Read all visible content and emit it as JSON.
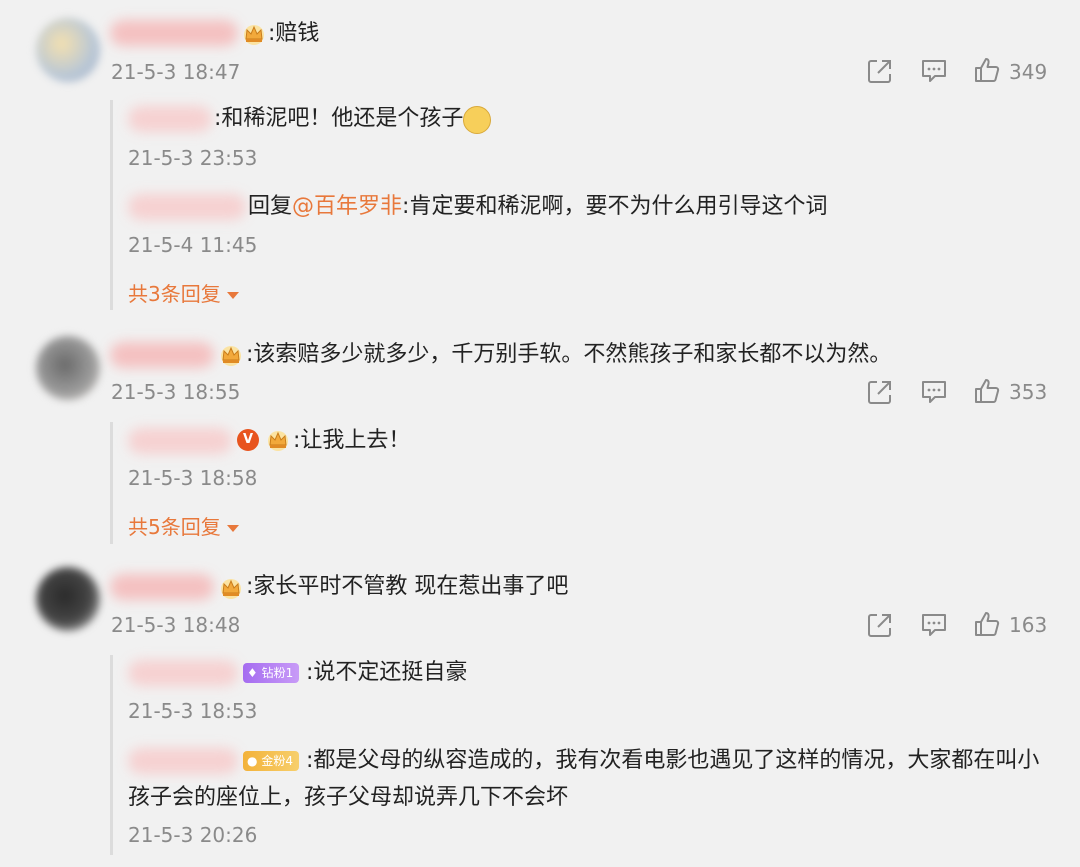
{
  "comments": [
    {
      "text": ":赔钱",
      "time": "21-5-3 18:47",
      "likes": "349",
      "replies": [
        {
          "text": ":和稀泥吧！他还是个孩子",
          "time": "21-5-3 23:53"
        },
        {
          "prefix": "回复",
          "mention": "@百年罗非",
          "text": ":肯定要和稀泥啊，要不为什么用引导这个词",
          "time": "21-5-4 11:45"
        }
      ],
      "more_replies": "共3条回复"
    },
    {
      "text": ":该索赔多少就多少，千万别手软。不然熊孩子和家长都不以为然。",
      "time": "21-5-3 18:55",
      "likes": "353",
      "replies": [
        {
          "text": ":让我上去！",
          "time": "21-5-3 18:58"
        }
      ],
      "more_replies": "共5条回复"
    },
    {
      "text": ":家长平时不管教 现在惹出事了吧",
      "time": "21-5-3 18:48",
      "likes": "163",
      "replies": [
        {
          "badge": "钻粉1",
          "text": ":说不定还挺自豪",
          "time": "21-5-3 18:53"
        },
        {
          "badge": "金粉4",
          "text_line1": ":都是父母的纵容造成的，我有次看电影也遇见了这样的情况，大家都在叫小",
          "text_line2": "孩子会的座位上，孩子父母却说弄几下不会坏",
          "time": "21-5-3 20:26"
        }
      ]
    }
  ],
  "icons": {
    "share": "share-icon",
    "comment": "comment-icon",
    "like": "thumbs-up-icon",
    "crown": "crown-badge-icon",
    "vip": "v-badge-icon",
    "emoji": "doge-emoji-icon"
  },
  "colors": {
    "background": "#f1f1f1",
    "accent": "#e8783b",
    "muted": "#8a8a8a"
  }
}
